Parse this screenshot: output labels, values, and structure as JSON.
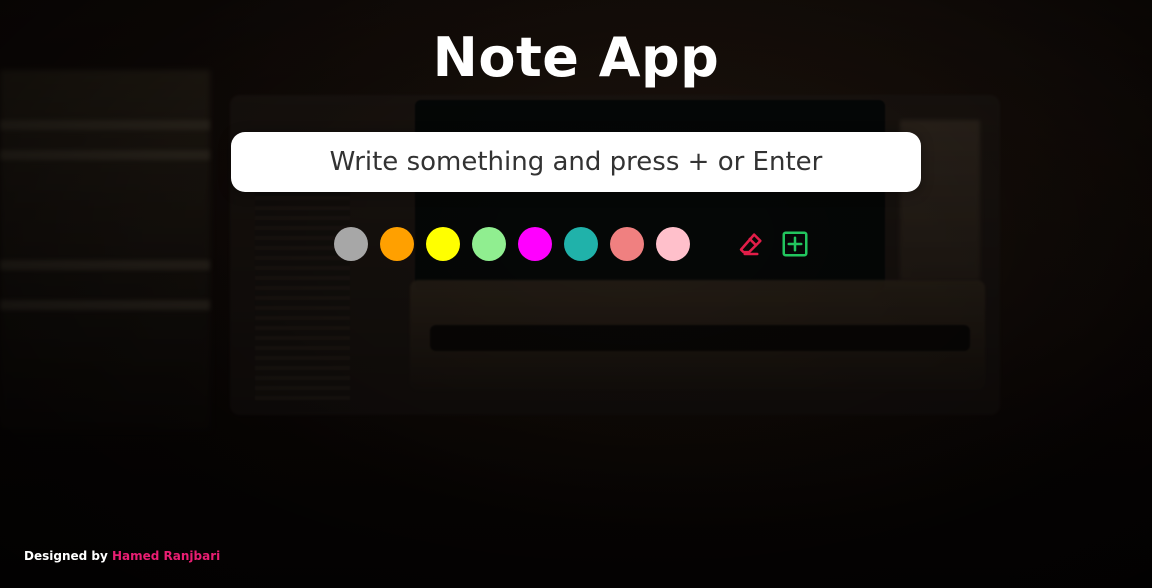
{
  "app": {
    "title": "Note App"
  },
  "input": {
    "placeholder": "Write something and press + or Enter",
    "value": ""
  },
  "colors": [
    {
      "name": "gray",
      "hex": "#a7a7a7"
    },
    {
      "name": "orange",
      "hex": "#ffa000"
    },
    {
      "name": "yellow",
      "hex": "#ffff00"
    },
    {
      "name": "lightgreen",
      "hex": "#90ee90"
    },
    {
      "name": "magenta",
      "hex": "#ff00ff"
    },
    {
      "name": "teal",
      "hex": "#20b2aa"
    },
    {
      "name": "lightcoral",
      "hex": "#f08080"
    },
    {
      "name": "pink",
      "hex": "#ffc0cb"
    }
  ],
  "actions": {
    "clear": {
      "icon": "eraser-icon",
      "color": "#e11d48"
    },
    "add": {
      "icon": "plus-square-icon",
      "color": "#22c55e"
    }
  },
  "footer": {
    "prefix": "Designed by",
    "author": "Hamed Ranjbari"
  }
}
